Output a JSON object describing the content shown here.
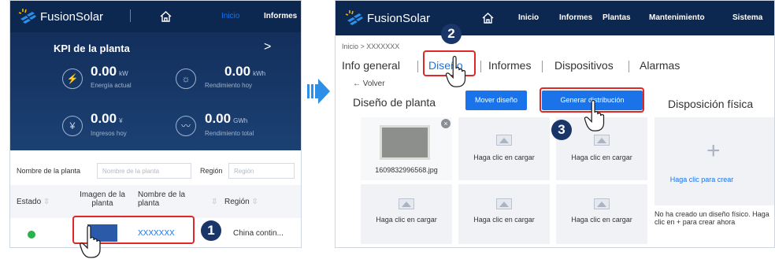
{
  "left": {
    "logo": "FusionSolar",
    "nav": {
      "inicio": "Inicio",
      "informes": "Informes"
    },
    "kpi": {
      "title": "KPI de la planta",
      "arrow": ">",
      "items": [
        {
          "value": "0.00",
          "unit": "kW",
          "caption": "Energía actual"
        },
        {
          "value": "0.00",
          "unit": "kWh",
          "caption": "Rendimiento hoy"
        },
        {
          "value": "0.00",
          "unit": "¥",
          "caption": "Ingresos hoy"
        },
        {
          "value": "0.00",
          "unit": "GWh",
          "caption": "Rendimiento total"
        }
      ]
    },
    "filter": {
      "plant_label": "Nombre de la planta",
      "plant_placeholder": "Nombre de la planta",
      "region_label": "Región",
      "region_placeholder": "Región"
    },
    "table": {
      "headers": [
        "Estado",
        "Imagen de la planta",
        "Nombre de la planta",
        "Región"
      ],
      "row": {
        "name": "XXXXXXX",
        "region": "China contin..."
      }
    }
  },
  "right": {
    "logo": "FusionSolar",
    "nav": [
      "Inicio",
      "Informes",
      "Plantas",
      "Mantenimiento",
      "Sistema"
    ],
    "breadcrumb": "Inicio > XXXXXXX",
    "tabs": [
      "Info general",
      "Diseño",
      "Informes",
      "Dispositivos",
      "Alarmas"
    ],
    "back": "← Volver",
    "design_title": "Diseño de planta",
    "move_button": "Mover diseño",
    "generate_button": "Generar distribución",
    "physical_title": "Disposición física",
    "file_name": "1609832996568.jpg",
    "upload_label": "Haga clic en cargar",
    "create_label": "Haga clic para crear",
    "empty_note": "No ha creado un diseño físico. Haga clic en + para crear ahora"
  },
  "annotations": {
    "step1": "1",
    "step2": "2",
    "step3": "3"
  },
  "colors": {
    "header": "#0c2750",
    "accent": "#1a73e8",
    "highlight": "#e12828",
    "status": "#2bb24c"
  }
}
